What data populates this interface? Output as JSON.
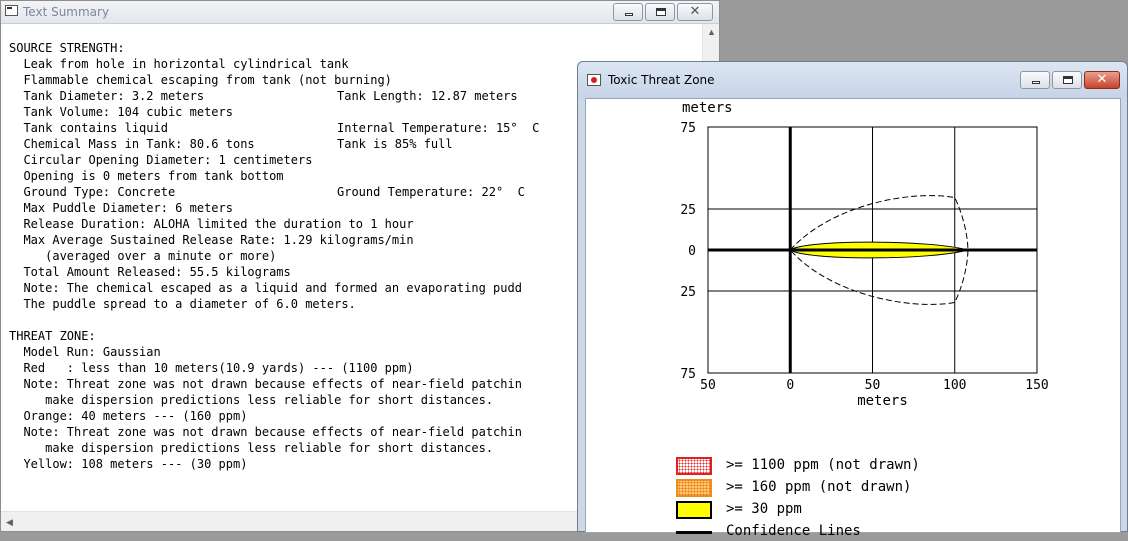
{
  "summary_window": {
    "title": "Text Summary",
    "lines": [
      "SOURCE STRENGTH:",
      "  Leak from hole in horizontal cylindrical tank",
      "  Flammable chemical escaping from tank (not burning)",
      "  Tank Diameter: 3.2 meters",
      "  Tank Volume: 104 cubic meters",
      "  Tank contains liquid",
      "  Chemical Mass in Tank: 80.6 tons",
      "  Circular Opening Diameter: 1 centimeters",
      "  Opening is 0 meters from tank bottom",
      "  Ground Type: Concrete",
      "  Max Puddle Diameter: 6 meters",
      "  Release Duration: ALOHA limited the duration to 1 hour",
      "  Max Average Sustained Release Rate: 1.29 kilograms/min",
      "     (averaged over a minute or more)",
      "  Total Amount Released: 55.5 kilograms",
      "  Note: The chemical escaped as a liquid and formed an evaporating pudd",
      "  The puddle spread to a diameter of 6.0 meters.",
      "",
      "THREAT ZONE:",
      "  Model Run: Gaussian",
      "  Red   : less than 10 meters(10.9 yards) --- (1100 ppm)",
      "  Note: Threat zone was not drawn because effects of near-field patchin",
      "     make dispersion predictions less reliable for short distances.",
      "  Orange: 40 meters --- (160 ppm)",
      "  Note: Threat zone was not drawn because effects of near-field patchin",
      "     make dispersion predictions less reliable for short distances.",
      "  Yellow: 108 meters --- (30 ppm)"
    ],
    "right_column": {
      "tank_length": "Tank Length: 12.87 meters",
      "internal_temp": "Internal Temperature: 15°  C",
      "tank_full": "Tank is 85% full",
      "ground_temp": "Ground Temperature: 22°  C"
    }
  },
  "threat_window": {
    "title": "Toxic Threat Zone",
    "legend": [
      {
        "label": ">= 1100 ppm (not drawn)",
        "fill": "#ffffff",
        "border": "#e02020",
        "pattern": "dots-red"
      },
      {
        "label": ">= 160 ppm (not drawn)",
        "fill": "#ffc872",
        "border": "#f08c1c",
        "pattern": "dots-orange"
      },
      {
        "label": ">= 30 ppm",
        "fill": "#ffff00",
        "border": "#000000",
        "pattern": "solid"
      },
      {
        "label": "Confidence Lines",
        "fill": "",
        "border": "#000000",
        "pattern": "line"
      }
    ]
  },
  "chart_data": {
    "type": "area",
    "xlabel": "meters",
    "ylabel": "meters",
    "xlim": [
      -50,
      150
    ],
    "ylim": [
      -75,
      75
    ],
    "x_ticks": [
      -50,
      0,
      50,
      100,
      150
    ],
    "x_tick_labels": [
      "50",
      "0",
      "50",
      "100",
      "150"
    ],
    "y_ticks": [
      75,
      25,
      0,
      -25,
      -75
    ],
    "y_tick_labels": [
      "75",
      "25",
      "0",
      "25",
      "75"
    ],
    "grid": true,
    "series": [
      {
        "name": ">= 30 ppm",
        "x": [
          0,
          108
        ],
        "half_width_max": 5,
        "color": "#ffff00"
      },
      {
        "name": "Confidence Lines",
        "x": [
          0,
          100,
          108
        ],
        "half_width_max": 32,
        "style": "dashed"
      }
    ]
  }
}
